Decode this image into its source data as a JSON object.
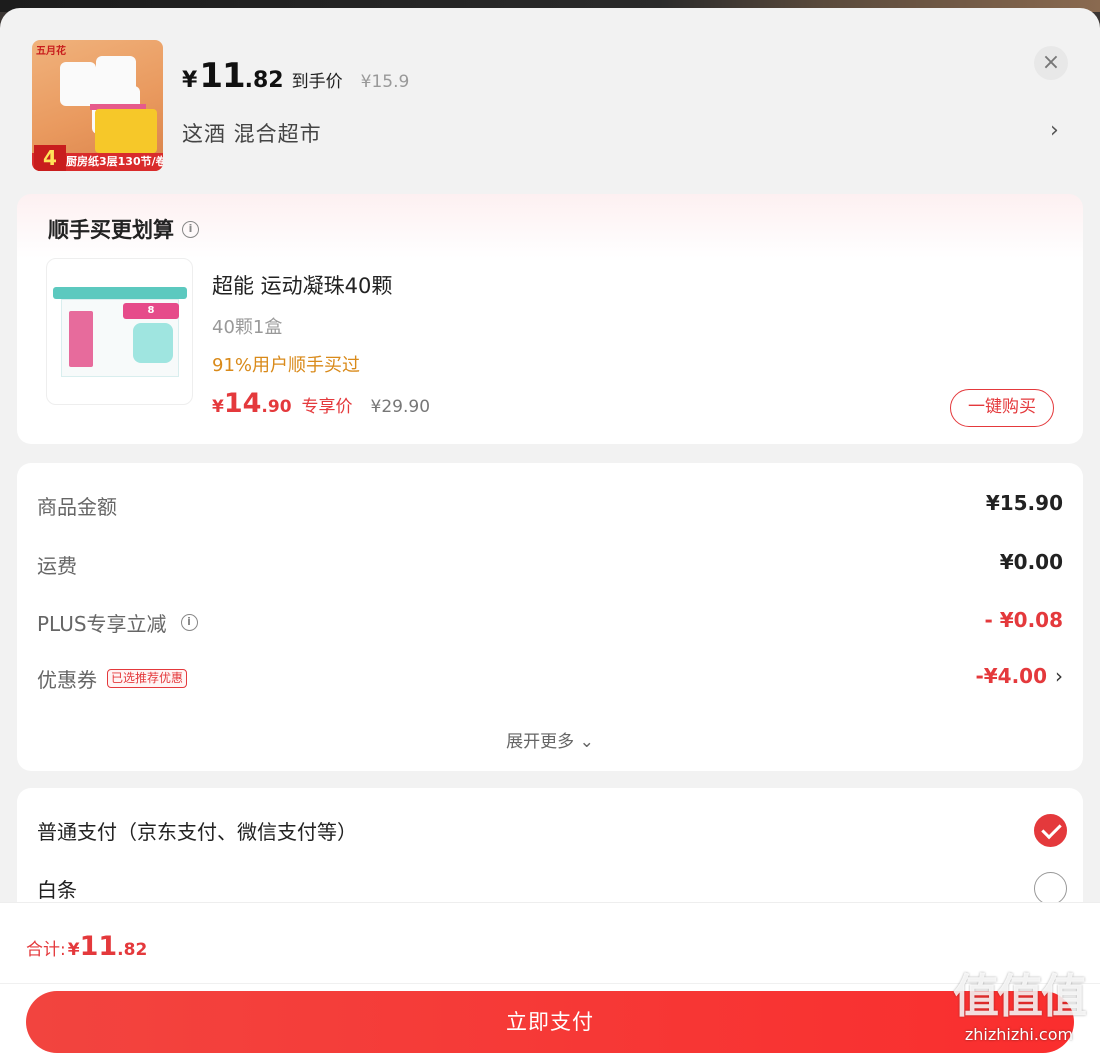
{
  "header": {
    "price": {
      "currency": "¥",
      "integer": "11",
      "decimal": ".82",
      "label": "到手价",
      "original": "¥15.9"
    },
    "shop": "这酒  混合超市",
    "shop_arrow": "›",
    "close": "×",
    "thumb": {
      "brand": "五月花",
      "badge_number": "4",
      "band_text": "厨房纸3层130节/卷"
    }
  },
  "upsell": {
    "title": "顺手买更划算",
    "info": "i",
    "thumb": {
      "badge": "8"
    },
    "product": {
      "name": "超能 运动凝珠40颗",
      "spec": "40颗1盒",
      "bought": "91%用户顺手买过",
      "price": {
        "currency": "¥",
        "integer": "14",
        "decimal": ".90",
        "tag": "专享价",
        "original": "¥29.90"
      },
      "button": "一键购买"
    }
  },
  "amounts": {
    "rows": [
      {
        "label": "商品金额",
        "value": "¥15.90"
      },
      {
        "label": "运费",
        "value": "¥0.00"
      },
      {
        "label": "PLUS专享立减",
        "value": "- ¥0.08"
      },
      {
        "label": "优惠券",
        "tag": "已选推荐优惠",
        "value": "-¥4.00"
      }
    ],
    "expand": "展开更多",
    "expand_icon": "⌄",
    "arrow": "›"
  },
  "payment": {
    "options": [
      {
        "label": "普通支付（京东支付、微信支付等）",
        "selected": true
      },
      {
        "label": "白条",
        "selected": false
      }
    ]
  },
  "bottom": {
    "total_label": "合计:",
    "total": {
      "currency": "¥",
      "integer": "11",
      "decimal": ".82"
    },
    "pay_button": "立即支付"
  },
  "watermark": {
    "big": "值值值",
    "small": "zhizhizhi.com"
  },
  "colors": {
    "accent": "#e4393c",
    "orange": "#d98a1a",
    "background": "#f2f2f2"
  }
}
